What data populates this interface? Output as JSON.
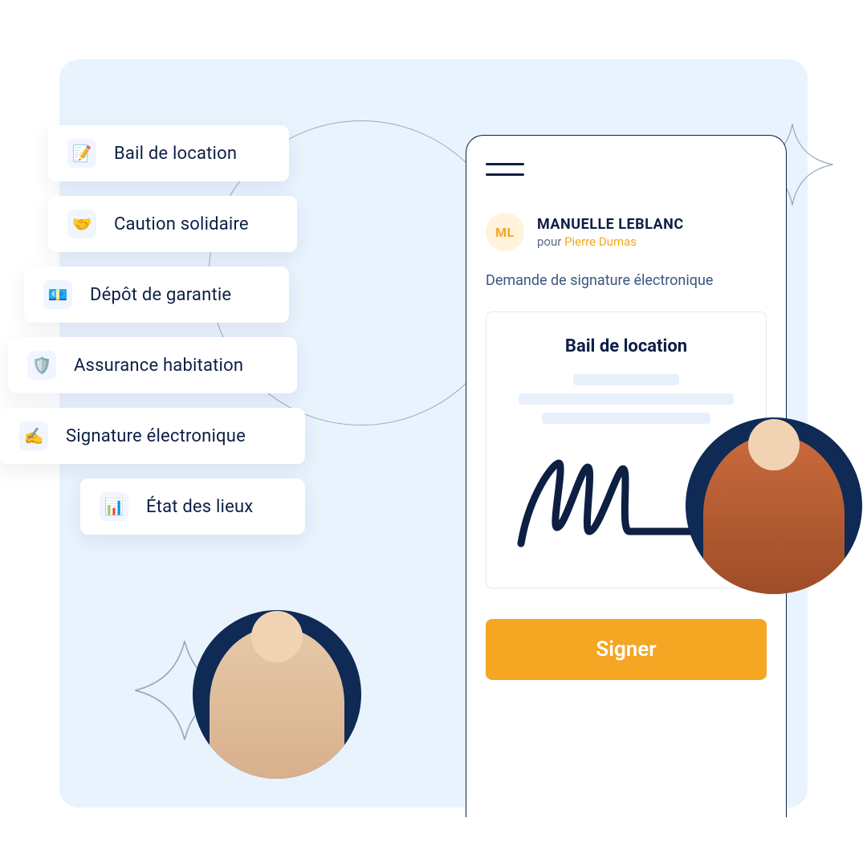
{
  "cards": [
    {
      "icon": "📝",
      "label": "Bail de location"
    },
    {
      "icon": "🤝",
      "label": "Caution solidaire"
    },
    {
      "icon": "💶",
      "label": "Dépôt de garantie"
    },
    {
      "icon": "🛡️",
      "label": "Assurance habitation"
    },
    {
      "icon": "✍️",
      "label": "Signature électronique"
    },
    {
      "icon": "📊",
      "label": "État des lieux"
    }
  ],
  "phone": {
    "avatar_initials": "ML",
    "user_name": "MANUELLE LEBLANC",
    "for_label": "pour ",
    "for_name": "Pierre Dumas",
    "subheading": "Demande de signature électronique",
    "document_title": "Bail de location",
    "sign_button": "Signer"
  }
}
